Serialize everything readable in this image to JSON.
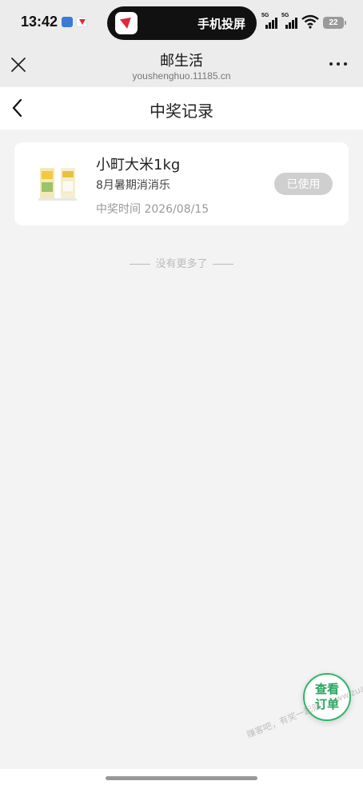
{
  "status_bar": {
    "time": "13:42",
    "island_text": "手机投屏",
    "signal_1_label": "5G",
    "signal_2_label": "5G",
    "battery": "22",
    "icons": [
      "message-notification-icon",
      "app-notification-icon",
      "wifi-icon"
    ]
  },
  "app_header": {
    "title": "邮生活",
    "url": "youshenghuo.11185.cn"
  },
  "page_header": {
    "title": "中奖记录"
  },
  "records": [
    {
      "name": "小町大米1kg",
      "activity": "8月暑期消消乐",
      "time": "中奖时间 2026/08/15",
      "status": "已使用"
    }
  ],
  "list_end_text": "没有更多了",
  "fab": {
    "label": "查看订单"
  },
  "watermark": "赚客吧，有奖一起赚！www.zuanke8.com",
  "colors": {
    "accent_green": "#24a75c",
    "badge_gray": "#cfcfcf",
    "page_background": "#f3f3f3"
  }
}
